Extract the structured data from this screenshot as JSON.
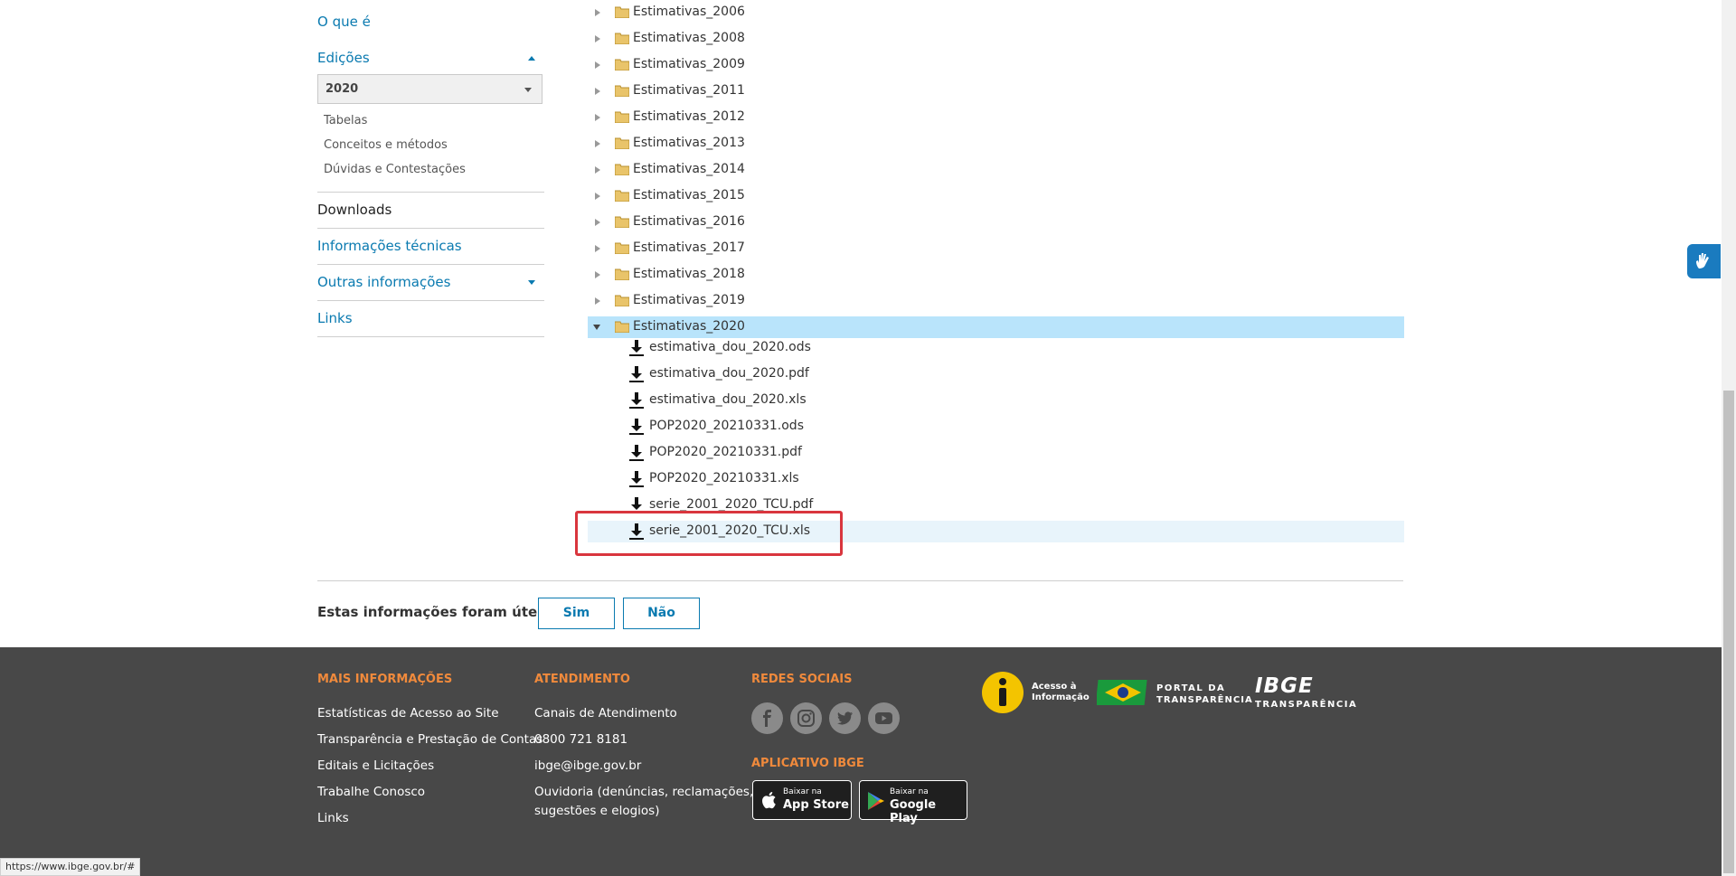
{
  "sidebar": {
    "o_que_e": "O que é",
    "edicoes": "Edições",
    "year_select": "2020",
    "sub_items": [
      "Tabelas",
      "Conceitos e métodos",
      "Dúvidas e Contestações"
    ],
    "downloads": "Downloads",
    "informacoes_tecnicas": "Informações técnicas",
    "outras_informacoes": "Outras informações",
    "links": "Links"
  },
  "tree": {
    "folders": [
      "Estimativas_2006",
      "Estimativas_2008",
      "Estimativas_2009",
      "Estimativas_2011",
      "Estimativas_2012",
      "Estimativas_2013",
      "Estimativas_2014",
      "Estimativas_2015",
      "Estimativas_2016",
      "Estimativas_2017",
      "Estimativas_2018",
      "Estimativas_2019"
    ],
    "expanded_folder": "Estimativas_2020",
    "files": [
      "estimativa_dou_2020.ods",
      "estimativa_dou_2020.pdf",
      "estimativa_dou_2020.xls",
      "POP2020_20210331.ods",
      "POP2020_20210331.pdf",
      "POP2020_20210331.xls",
      "serie_2001_2020_TCU.pdf",
      "serie_2001_2020_TCU.xls"
    ],
    "highlighted_file": "serie_2001_2020_TCU.xls"
  },
  "feedback": {
    "question": "Estas informações foram úteis?",
    "yes": "Sim",
    "no": "Não"
  },
  "footer": {
    "mais_informacoes": {
      "heading": "MAIS INFORMAÇÕES",
      "links": [
        "Estatísticas de Acesso ao Site",
        "Transparência e Prestação de Contas",
        "Editais e Licitações",
        "Trabalhe Conosco",
        "Links"
      ]
    },
    "atendimento": {
      "heading": "ATENDIMENTO",
      "links": [
        "Canais de Atendimento",
        "0800 721 8181",
        "ibge@ibge.gov.br"
      ],
      "ouvidoria_line1": "Ouvidoria (denúncias, reclamações,",
      "ouvidoria_line2": "sugestões e elogios)"
    },
    "redes_sociais": {
      "heading": "REDES SOCIAIS",
      "icons": [
        "facebook-icon",
        "instagram-icon",
        "twitter-icon",
        "youtube-icon"
      ]
    },
    "aplicativo": {
      "heading": "APLICATIVO IBGE",
      "app_store_small": "Baixar na",
      "app_store_big": "App Store",
      "google_play_small": "Baixar na",
      "google_play_big": "Google Play"
    },
    "logos": {
      "acesso_line1": "Acesso à",
      "acesso_line2": "Informação",
      "portal_line1": "PORTAL DA",
      "portal_line2": "TRANSPARÊNCIA",
      "ibge_line1": "IBGE",
      "ibge_line2": "TRANSPARÊNCIA"
    }
  },
  "status_bar": {
    "url": "https://www.ibge.gov.br/#"
  },
  "colors": {
    "link_blue": "#0a7ab0",
    "footer_bg": "#484848",
    "footer_heading": "#f08a3c",
    "highlight_red": "#d9363e",
    "selected_row": "#b9e4fb"
  }
}
